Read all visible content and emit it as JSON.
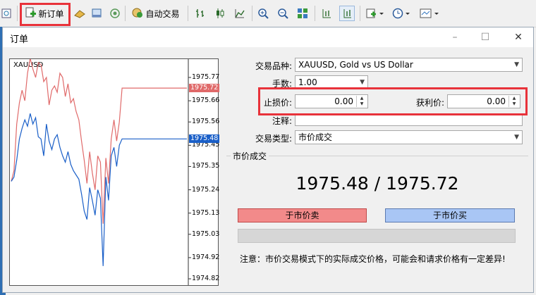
{
  "toolbar": {
    "new_order_label": "新订单",
    "auto_trading_label": "自动交易",
    "icons": [
      "navigator-icon",
      "new-order-icon",
      "market-watch-icon",
      "data-window-icon",
      "signals-icon",
      "auto-trading-icon",
      "bar-chart-icon",
      "candlestick-icon",
      "line-chart-icon",
      "zoom-in-icon",
      "zoom-out-icon",
      "tile-windows-icon",
      "chart-shift-icon",
      "autoscroll-icon",
      "indicators-icon",
      "periods-icon",
      "templates-icon"
    ]
  },
  "dialog": {
    "title": "订单",
    "minimize": "–",
    "maximize": "☐",
    "close": "✕"
  },
  "chart": {
    "symbol": "XAUUSD",
    "ticks": [
      "1975.77",
      "1975.66",
      "1975.56",
      "1975.45",
      "1975.35",
      "1975.24",
      "1975.13",
      "1975.03",
      "1974.92",
      "1974.82"
    ],
    "ask_tag": "1975.72",
    "bid_tag": "1975.48",
    "ask_color": "#e06a6a",
    "bid_color": "#1a5fc8"
  },
  "chart_data": {
    "type": "line",
    "ylim": [
      1974.82,
      1975.77
    ],
    "series": [
      {
        "name": "",
        "color": "#e06a6a",
        "values": [
          1975.28,
          1975.33,
          1975.55,
          1975.65,
          1975.71,
          1975.66,
          1975.79,
          1975.86,
          1975.81,
          1975.77,
          1975.84,
          1975.83,
          1975.75,
          1975.77,
          1975.64,
          1975.71,
          1975.73,
          1975.7,
          1975.79,
          1975.77,
          1975.68,
          1975.74,
          1975.65,
          1975.67,
          1975.61,
          1975.57,
          1975.47,
          1975.38,
          1975.27,
          1975.42,
          1975.32,
          1975.24,
          1975.4,
          1975.37,
          1975.08,
          1975.39,
          1975.27,
          1975.48,
          1975.57,
          1975.47,
          1975.56,
          1975.72,
          1975.72,
          1975.72,
          1975.72,
          1975.72,
          1975.72,
          1975.72,
          1975.72,
          1975.72,
          1975.72,
          1975.72,
          1975.72,
          1975.72,
          1975.72,
          1975.72,
          1975.72,
          1975.72,
          1975.72,
          1975.72,
          1975.72,
          1975.72,
          1975.72,
          1975.72,
          1975.72,
          1975.72
        ]
      },
      {
        "name": "",
        "color": "#1a5fc8",
        "values": [
          1975.28,
          1975.3,
          1975.38,
          1975.48,
          1975.53,
          1975.57,
          1975.54,
          1975.6,
          1975.55,
          1975.58,
          1975.49,
          1975.48,
          1975.4,
          1975.55,
          1975.47,
          1975.43,
          1975.48,
          1975.5,
          1975.44,
          1975.4,
          1975.37,
          1975.42,
          1975.36,
          1975.33,
          1975.31,
          1975.29,
          1975.22,
          1975.14,
          1975.1,
          1975.25,
          1975.19,
          1975.12,
          1975.24,
          1975.2,
          1974.88,
          1975.3,
          1975.19,
          1975.4,
          1975.44,
          1975.35,
          1975.45,
          1975.48,
          1975.48,
          1975.48,
          1975.48,
          1975.48,
          1975.48,
          1975.48,
          1975.48,
          1975.48,
          1975.48,
          1975.48,
          1975.48,
          1975.48,
          1975.48,
          1975.48,
          1975.48,
          1975.48,
          1975.48,
          1975.48,
          1975.48,
          1975.48,
          1975.48,
          1975.48,
          1975.48,
          1975.48
        ]
      }
    ]
  },
  "form": {
    "symbol_label": "交易品种:",
    "symbol_value": "XAUUSD, Gold vs US Dollar",
    "volume_label": "手数:",
    "volume_value": "1.00",
    "stoploss_label": "止损价:",
    "stoploss_value": "0.00",
    "takeprofit_label": "获利价:",
    "takeprofit_value": "0.00",
    "comment_label": "注释:",
    "type_label": "交易类型:",
    "type_value": "市价成交"
  },
  "market": {
    "group_title": "市价成交",
    "prices_text": "1975.48 / 1975.72",
    "sell_label": "于市价卖",
    "buy_label": "于市价买",
    "note": "注意：市价交易模式下的实际成交价格，可能会和请求价格有一定差异!",
    "sell_color": "#f28a8a",
    "buy_color": "#a9c6f5"
  },
  "highlight_color": "#e8323a"
}
